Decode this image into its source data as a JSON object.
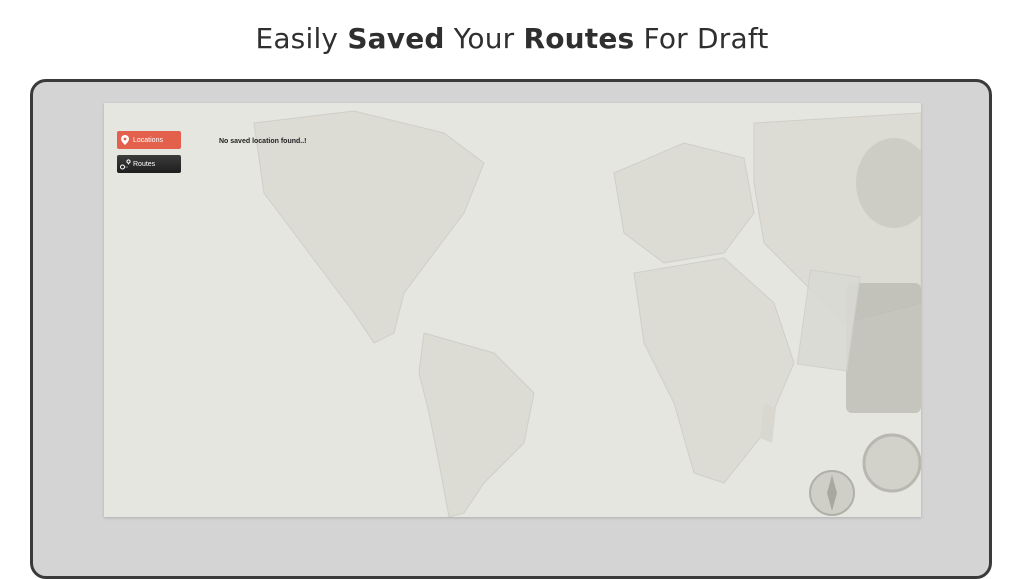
{
  "headline": {
    "part1": "Easily ",
    "bold1": "Saved",
    "part2": " Your ",
    "bold2": "Routes",
    "part3": " For Draft"
  },
  "sidebar": {
    "items": [
      {
        "label": "Locations",
        "icon": "map-pin-icon",
        "active": true,
        "color": "#e2604c"
      },
      {
        "label": "Routes",
        "icon": "route-icon",
        "active": false,
        "color": "#2b2b2b"
      }
    ]
  },
  "main": {
    "empty_message": "No saved location found..!"
  }
}
